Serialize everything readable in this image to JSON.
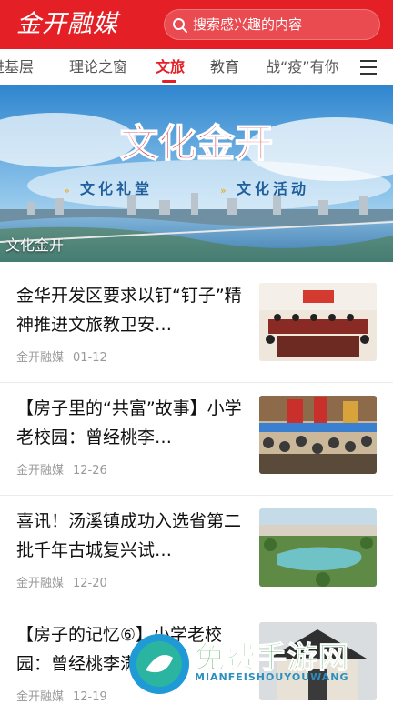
{
  "header": {
    "logo_text": "金开融媒",
    "search_placeholder": "搜索感兴趣的内容"
  },
  "tabs": [
    {
      "label": "进基层",
      "active": false
    },
    {
      "label": "理论之窗",
      "active": false
    },
    {
      "label": "文旅",
      "active": true
    },
    {
      "label": "教育",
      "active": false
    },
    {
      "label": "战“疫”有你",
      "active": false
    }
  ],
  "banner": {
    "title": "文化金开",
    "sub_left": "文化礼堂",
    "sub_right": "文化活动",
    "caption": "文化金开"
  },
  "articles": [
    {
      "title": "金华开发区要求以钉“钉子”精神推进文旅教卫安…",
      "source": "金开融媒",
      "date": "01-12",
      "thumb": "meeting-photo"
    },
    {
      "title": "【房子里的“共富”故事】小学老校园：曾经桃李…",
      "source": "金开融媒",
      "date": "12-26",
      "thumb": "market-photo"
    },
    {
      "title": "喜讯！汤溪镇成功入选省第二批千年古城复兴试…",
      "source": "金开融媒",
      "date": "12-20",
      "thumb": "aerial-town-photo"
    },
    {
      "title": "【房子的记忆⑥】小学老校园：曾经桃李满天下…",
      "source": "金开融媒",
      "date": "12-19",
      "thumb": "old-building-photo"
    }
  ],
  "watermark": {
    "text": "免费手游网",
    "sub": "MIANFEISHOUYOUWANG"
  },
  "colors": {
    "brand_red": "#e41f25",
    "banner_title": "#c8142a",
    "watermark_green": "#3aa64a"
  }
}
